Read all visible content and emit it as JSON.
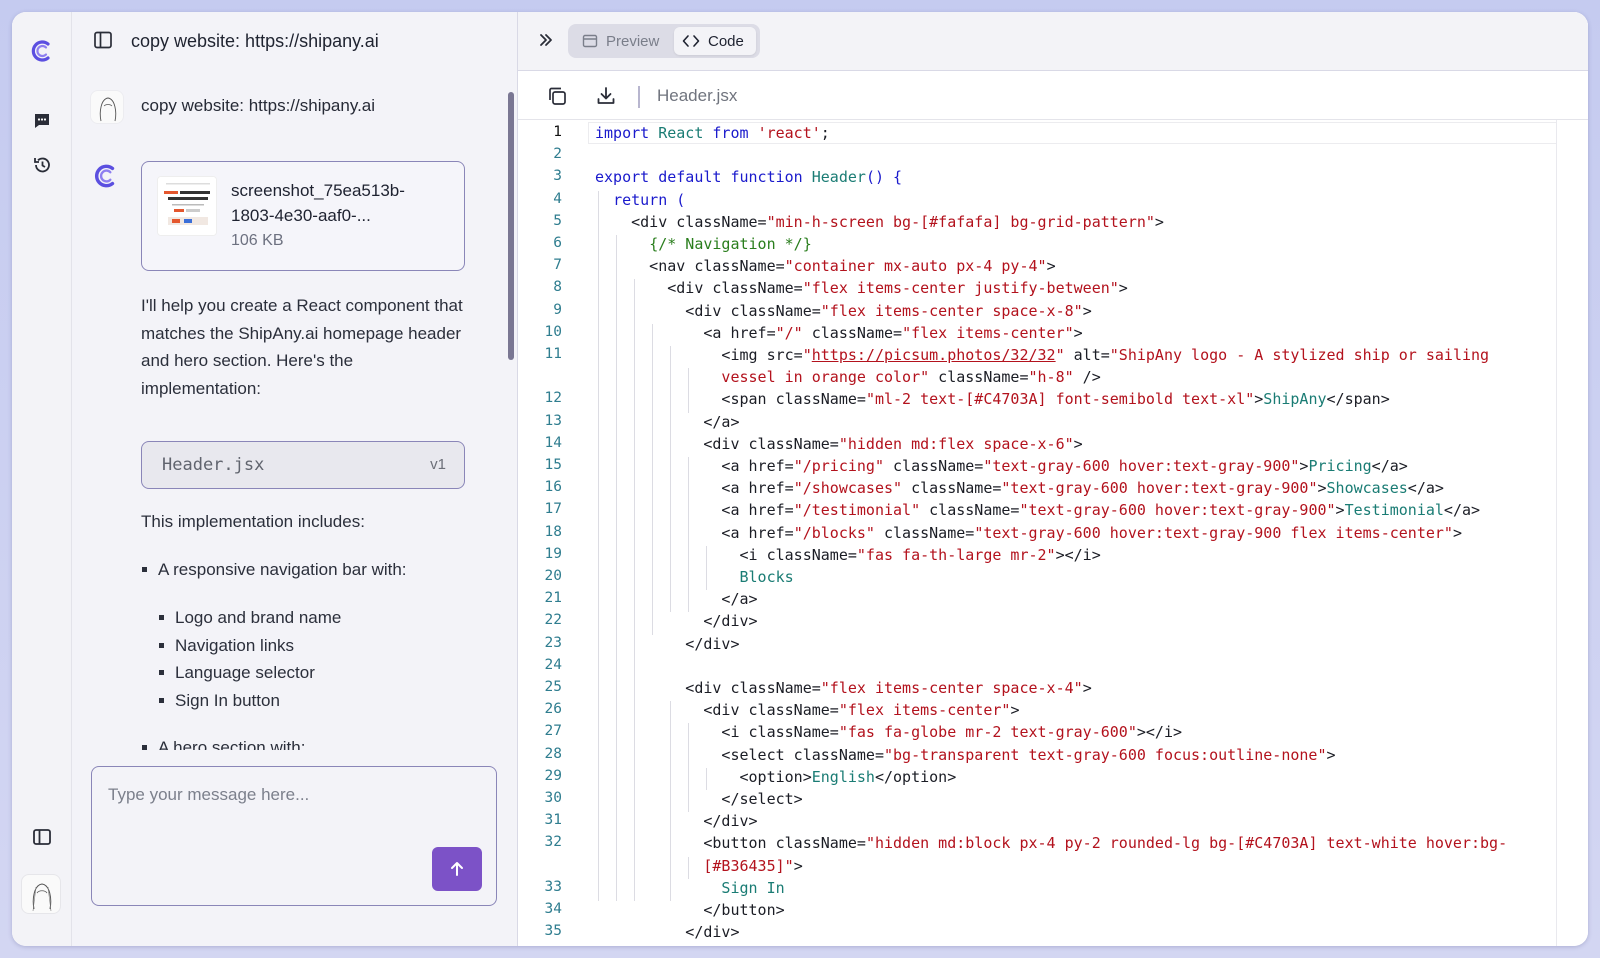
{
  "chat": {
    "title": "copy website: https://shipany.ai",
    "user_message": "copy website: https://shipany.ai",
    "attachment": {
      "name_line1": "screenshot_75ea513b-",
      "name_line2": "1803-4e30-aaf0-...",
      "size": "106 KB"
    },
    "intro": "I'll help you create a React component that matches the ShipAny.ai homepage header and hero section. Here's the implementation:",
    "code_chip": {
      "file": "Header.jsx",
      "version": "v1"
    },
    "includes_label": "This implementation includes:",
    "list_top": "A responsive navigation bar with:",
    "list_sub": [
      "Logo and brand name",
      "Navigation links",
      "Language selector",
      "Sign In button"
    ],
    "list_next": "A hero section with:",
    "composer_placeholder": "Type your message here..."
  },
  "rail": {
    "icons": [
      "app-logo",
      "chat-icon",
      "history-icon",
      "sidebar-toggle-icon",
      "user-avatar"
    ]
  },
  "right": {
    "tabs": {
      "preview": "Preview",
      "code": "Code",
      "active": "code"
    },
    "filename": "Header.jsx"
  },
  "code": {
    "line_numbers": [
      "1",
      "2",
      "3",
      "4",
      "5",
      "6",
      "7",
      "8",
      "9",
      "10",
      "11",
      "",
      "12",
      "13",
      "14",
      "15",
      "16",
      "17",
      "18",
      "19",
      "20",
      "21",
      "22",
      "23",
      "24",
      "25",
      "26",
      "27",
      "28",
      "29",
      "30",
      "31",
      "32",
      "",
      "33",
      "34",
      "35"
    ],
    "lines": [
      [
        [
          "k",
          "import "
        ],
        [
          "t",
          "React "
        ],
        [
          "k",
          "from "
        ],
        [
          "s",
          "'react'"
        ],
        [
          "p",
          ";"
        ]
      ],
      [],
      [
        [
          "k",
          "export default function "
        ],
        [
          "t",
          "Header"
        ],
        [
          "k",
          "() {"
        ]
      ],
      [
        [
          "p",
          "  "
        ],
        [
          "k",
          "return ("
        ]
      ],
      [
        [
          "p",
          "    <div className="
        ],
        [
          "s",
          "\"min-h-screen bg-[#fafafa] bg-grid-pattern\""
        ],
        [
          "p",
          ">"
        ]
      ],
      [
        [
          "p",
          "      "
        ],
        [
          "c",
          "{/* Navigation */}"
        ]
      ],
      [
        [
          "p",
          "      <nav className="
        ],
        [
          "s",
          "\"container mx-auto px-4 py-4\""
        ],
        [
          "p",
          ">"
        ]
      ],
      [
        [
          "p",
          "        <div className="
        ],
        [
          "s",
          "\"flex items-center justify-between\""
        ],
        [
          "p",
          ">"
        ]
      ],
      [
        [
          "p",
          "          <div className="
        ],
        [
          "s",
          "\"flex items-center space-x-8\""
        ],
        [
          "p",
          ">"
        ]
      ],
      [
        [
          "p",
          "            <a href="
        ],
        [
          "s",
          "\"/\""
        ],
        [
          "p",
          " className="
        ],
        [
          "s",
          "\"flex items-center\""
        ],
        [
          "p",
          ">"
        ]
      ],
      [
        [
          "p",
          "              <img src="
        ],
        [
          "s",
          "\""
        ],
        [
          "u",
          "https://picsum.photos/32/32"
        ],
        [
          "s",
          "\""
        ],
        [
          "p",
          " alt="
        ],
        [
          "s",
          "\"ShipAny logo - A stylized ship or sailing"
        ]
      ],
      [
        [
          "s",
          "              vessel in orange color\""
        ],
        [
          "p",
          " className="
        ],
        [
          "s",
          "\"h-8\""
        ],
        [
          "p",
          " />"
        ]
      ],
      [
        [
          "p",
          "              <span className="
        ],
        [
          "s",
          "\"ml-2 text-[#C4703A] font-semibold text-xl\""
        ],
        [
          "p",
          ">"
        ],
        [
          "t",
          "ShipAny"
        ],
        [
          "p",
          "</span>"
        ]
      ],
      [
        [
          "p",
          "            </a>"
        ]
      ],
      [
        [
          "p",
          "            <div className="
        ],
        [
          "s",
          "\"hidden md:flex space-x-6\""
        ],
        [
          "p",
          ">"
        ]
      ],
      [
        [
          "p",
          "              <a href="
        ],
        [
          "s",
          "\"/pricing\""
        ],
        [
          "p",
          " className="
        ],
        [
          "s",
          "\"text-gray-600 hover:text-gray-900\""
        ],
        [
          "p",
          ">"
        ],
        [
          "t",
          "Pricing"
        ],
        [
          "p",
          "</a>"
        ]
      ],
      [
        [
          "p",
          "              <a href="
        ],
        [
          "s",
          "\"/showcases\""
        ],
        [
          "p",
          " className="
        ],
        [
          "s",
          "\"text-gray-600 hover:text-gray-900\""
        ],
        [
          "p",
          ">"
        ],
        [
          "t",
          "Showcases"
        ],
        [
          "p",
          "</a>"
        ]
      ],
      [
        [
          "p",
          "              <a href="
        ],
        [
          "s",
          "\"/testimonial\""
        ],
        [
          "p",
          " className="
        ],
        [
          "s",
          "\"text-gray-600 hover:text-gray-900\""
        ],
        [
          "p",
          ">"
        ],
        [
          "t",
          "Testimonial"
        ],
        [
          "p",
          "</a>"
        ]
      ],
      [
        [
          "p",
          "              <a href="
        ],
        [
          "s",
          "\"/blocks\""
        ],
        [
          "p",
          " className="
        ],
        [
          "s",
          "\"text-gray-600 hover:text-gray-900 flex items-center\""
        ],
        [
          "p",
          ">"
        ]
      ],
      [
        [
          "p",
          "                <i className="
        ],
        [
          "s",
          "\"fas fa-th-large mr-2\""
        ],
        [
          "p",
          "></i>"
        ]
      ],
      [
        [
          "t",
          "                Blocks"
        ]
      ],
      [
        [
          "p",
          "              </a>"
        ]
      ],
      [
        [
          "p",
          "            </div>"
        ]
      ],
      [
        [
          "p",
          "          </div>"
        ]
      ],
      [],
      [
        [
          "p",
          "          <div className="
        ],
        [
          "s",
          "\"flex items-center space-x-4\""
        ],
        [
          "p",
          ">"
        ]
      ],
      [
        [
          "p",
          "            <div className="
        ],
        [
          "s",
          "\"flex items-center\""
        ],
        [
          "p",
          ">"
        ]
      ],
      [
        [
          "p",
          "              <i className="
        ],
        [
          "s",
          "\"fas fa-globe mr-2 text-gray-600\""
        ],
        [
          "p",
          "></i>"
        ]
      ],
      [
        [
          "p",
          "              <select className="
        ],
        [
          "s",
          "\"bg-transparent text-gray-600 focus:outline-none\""
        ],
        [
          "p",
          ">"
        ]
      ],
      [
        [
          "p",
          "                <option>"
        ],
        [
          "t",
          "English"
        ],
        [
          "p",
          "</option>"
        ]
      ],
      [
        [
          "p",
          "              </select>"
        ]
      ],
      [
        [
          "p",
          "            </div>"
        ]
      ],
      [
        [
          "p",
          "            <button className="
        ],
        [
          "s",
          "\"hidden md:block px-4 py-2 rounded-lg bg-[#C4703A] text-white hover:bg-"
        ]
      ],
      [
        [
          "s",
          "            [#B36435]\""
        ],
        [
          "p",
          ">"
        ]
      ],
      [
        [
          "t",
          "              Sign In"
        ]
      ],
      [
        [
          "p",
          "            </button>"
        ]
      ],
      [
        [
          "p",
          "          </div>"
        ]
      ]
    ]
  }
}
